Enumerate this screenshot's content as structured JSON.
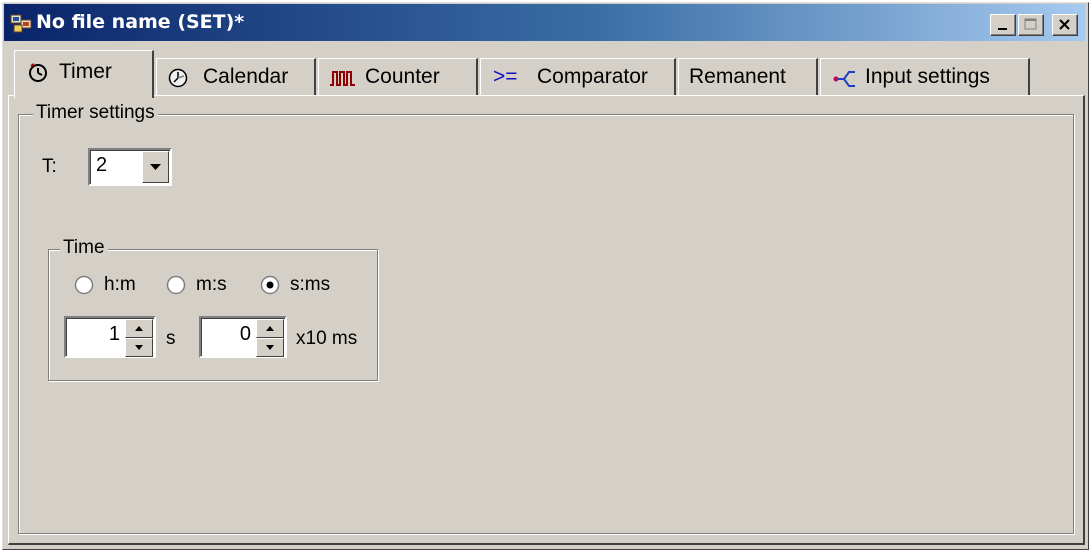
{
  "window": {
    "title": "No file name (SET)*",
    "titlebar_colors": [
      "#0a246a",
      "#a6caf0"
    ],
    "icons": {
      "app": "app-icon",
      "minimize": "minimize-icon",
      "maximize": "maximize-icon",
      "close": "close-icon"
    }
  },
  "tabs": [
    {
      "label": "Timer",
      "icon": "clock-icon",
      "active": true
    },
    {
      "label": "Calendar",
      "icon": "calendar-clock-icon",
      "active": false
    },
    {
      "label": "Counter",
      "icon": "pulse-counter-icon",
      "active": false
    },
    {
      "label": "Comparator",
      "icon": "comparator-icon",
      "active": false
    },
    {
      "label": "Remanent",
      "icon": "",
      "active": false
    },
    {
      "label": "Input settings",
      "icon": "input-settings-icon",
      "active": false
    }
  ],
  "timer_settings": {
    "group_title": "Timer settings",
    "t_label": "T:",
    "t_value": "2",
    "time_group": {
      "title": "Time",
      "options": [
        "h:m",
        "m:s",
        "s:ms"
      ],
      "selected": "s:ms",
      "first_value": "1",
      "first_unit": "s",
      "second_value": "0",
      "second_unit": "x10 ms"
    }
  }
}
